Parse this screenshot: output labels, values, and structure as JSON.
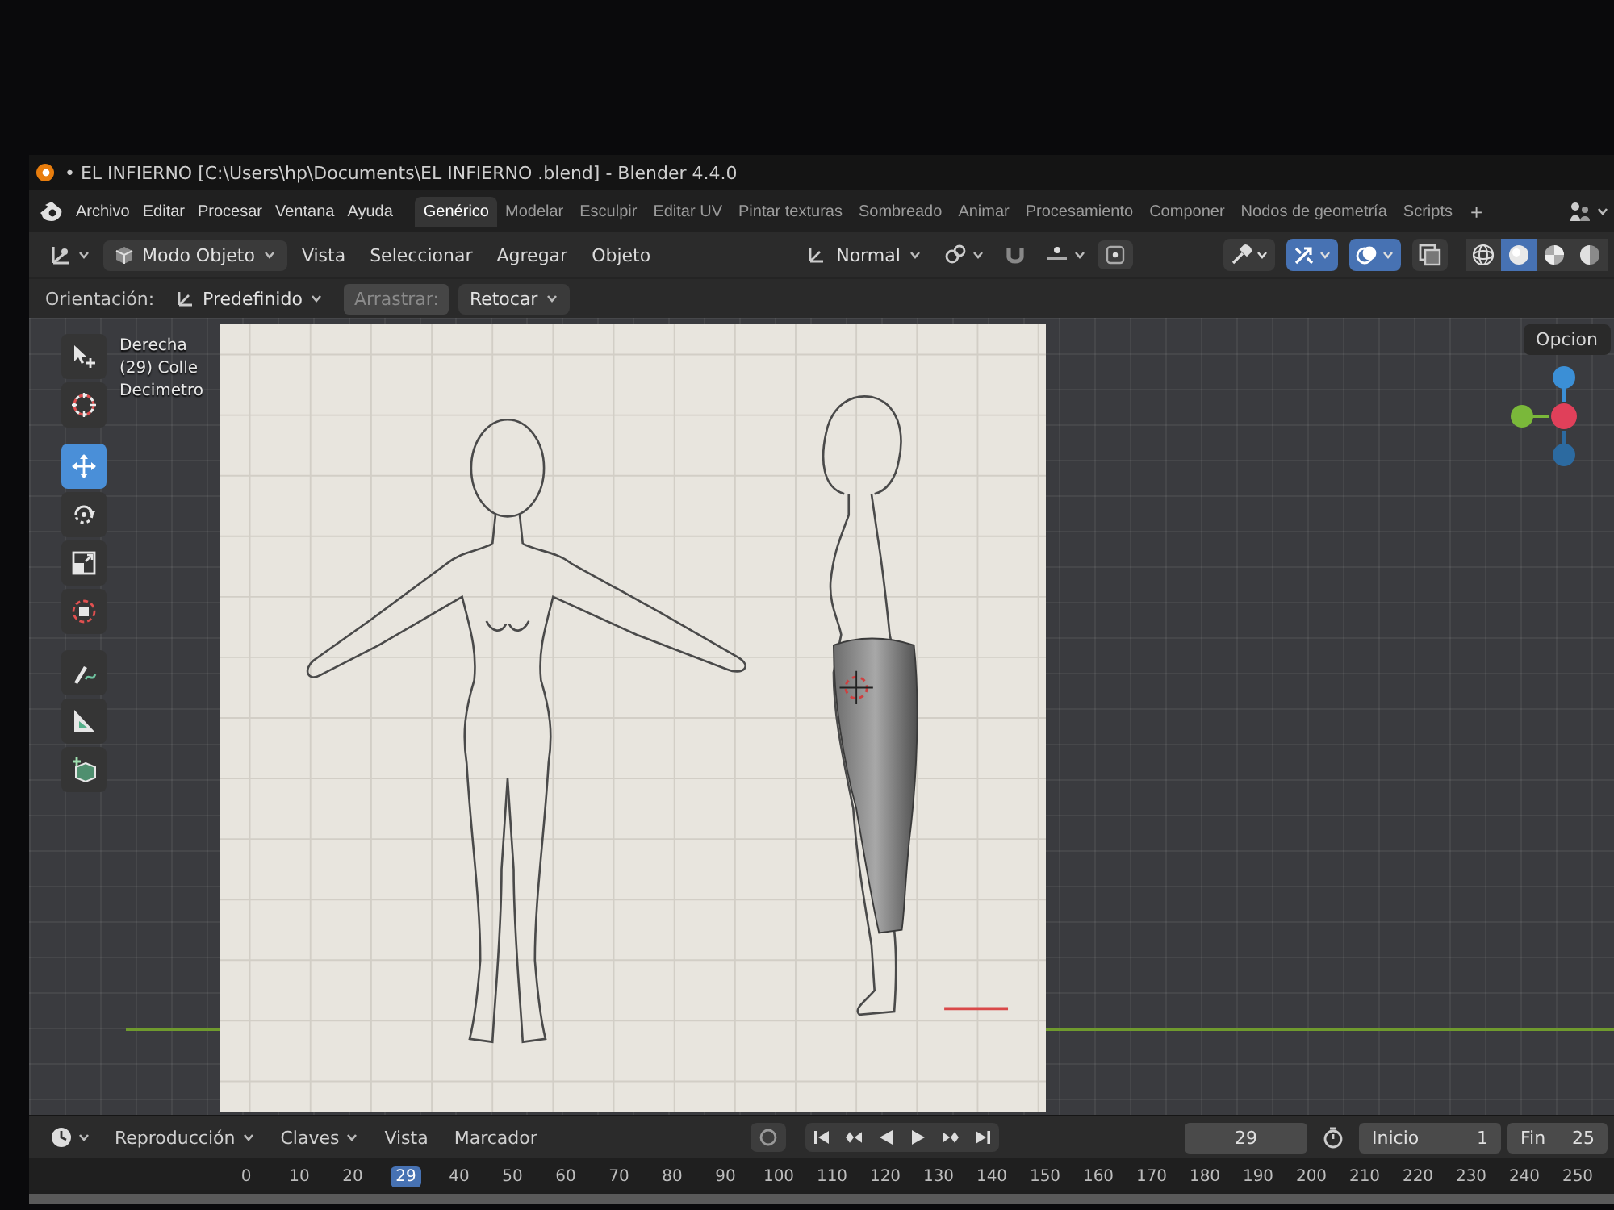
{
  "window": {
    "title": "• EL INFIERNO [C:\\Users\\hp\\Documents\\EL INFIERNO .blend] - Blender 4.4.0"
  },
  "topbar": {
    "menus": [
      "Archivo",
      "Editar",
      "Procesar",
      "Ventana",
      "Ayuda"
    ],
    "workspaces": [
      {
        "label": "Genérico",
        "selected": true
      },
      {
        "label": "Modelar",
        "selected": false
      },
      {
        "label": "Esculpir",
        "selected": false
      },
      {
        "label": "Editar UV",
        "selected": false
      },
      {
        "label": "Pintar texturas",
        "selected": false
      },
      {
        "label": "Sombreado",
        "selected": false
      },
      {
        "label": "Animar",
        "selected": false
      },
      {
        "label": "Procesamiento",
        "selected": false
      },
      {
        "label": "Componer",
        "selected": false
      },
      {
        "label": "Nodos de geometría",
        "selected": false
      },
      {
        "label": "Scripts",
        "selected": false
      }
    ],
    "add_workspace": "+"
  },
  "viewport_header": {
    "mode": "Modo Objeto",
    "menus": [
      "Vista",
      "Seleccionar",
      "Agregar",
      "Objeto"
    ],
    "orientation": "Normal",
    "toggles": [
      {
        "kind": "object-types",
        "on": false
      },
      {
        "kind": "gizmos",
        "on": true
      },
      {
        "kind": "overlays",
        "on": true
      },
      {
        "kind": "xray",
        "on": false
      }
    ],
    "shading": [
      {
        "kind": "wireframe",
        "selected": false
      },
      {
        "kind": "solid",
        "selected": true
      },
      {
        "kind": "material",
        "selected": false
      },
      {
        "kind": "rendered",
        "selected": false
      }
    ]
  },
  "tool_settings": {
    "orientation_label": "Orientación:",
    "orientation": "Predefinido",
    "drag_label": "Arrastrar:",
    "drag": "Retocar"
  },
  "toolbar": [
    {
      "kind": "select",
      "selected": false
    },
    {
      "kind": "cursor",
      "selected": false
    },
    {
      "kind": "move",
      "selected": true
    },
    {
      "kind": "rotate",
      "selected": false
    },
    {
      "kind": "scale",
      "selected": false
    },
    {
      "kind": "transform",
      "selected": false
    },
    {
      "kind": "annotate",
      "selected": false
    },
    {
      "kind": "measure",
      "selected": false
    },
    {
      "kind": "add-cube",
      "selected": false
    }
  ],
  "viewport": {
    "overlay_text": [
      "Derecha",
      "(29) Colle",
      "Decimetro"
    ],
    "options": "Opcion"
  },
  "timeline": {
    "menus": [
      {
        "label": "Reproducción",
        "dropdown": true
      },
      {
        "label": "Claves",
        "dropdown": true
      },
      {
        "label": "Vista",
        "dropdown": false
      },
      {
        "label": "Marcador",
        "dropdown": false
      }
    ],
    "current_frame": "29",
    "start_label": "Inicio",
    "start": "1",
    "end_label": "Fin",
    "end": "25",
    "frames": [
      {
        "label": "0",
        "selected": false
      },
      {
        "label": "10",
        "selected": false
      },
      {
        "label": "20",
        "selected": false
      },
      {
        "label": "29",
        "selected": true
      },
      {
        "label": "40",
        "selected": false
      },
      {
        "label": "50",
        "selected": false
      },
      {
        "label": "60",
        "selected": false
      },
      {
        "label": "70",
        "selected": false
      },
      {
        "label": "80",
        "selected": false
      },
      {
        "label": "90",
        "selected": false
      },
      {
        "label": "100",
        "selected": false
      },
      {
        "label": "110",
        "selected": false
      },
      {
        "label": "120",
        "selected": false
      },
      {
        "label": "130",
        "selected": false
      },
      {
        "label": "140",
        "selected": false
      },
      {
        "label": "150",
        "selected": false
      },
      {
        "label": "160",
        "selected": false
      },
      {
        "label": "170",
        "selected": false
      },
      {
        "label": "180",
        "selected": false
      },
      {
        "label": "190",
        "selected": false
      },
      {
        "label": "200",
        "selected": false
      },
      {
        "label": "210",
        "selected": false
      },
      {
        "label": "220",
        "selected": false
      },
      {
        "label": "230",
        "selected": false
      },
      {
        "label": "240",
        "selected": false
      },
      {
        "label": "250",
        "selected": false
      }
    ]
  }
}
